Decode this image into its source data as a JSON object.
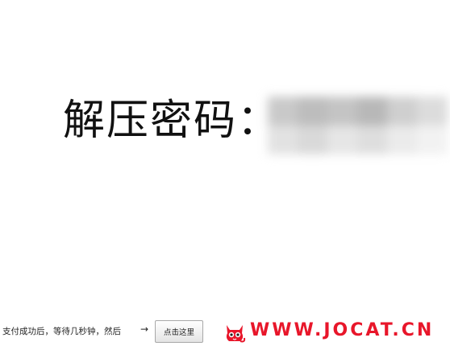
{
  "heading": {
    "label": "解压密码："
  },
  "footer": {
    "instruction": "支付成功后，等待几秒钟，然后",
    "arrow": "→",
    "button_label": "点击这里"
  },
  "logo": {
    "text": "WWW.JOCAT.CN",
    "icon": "cat-icon",
    "color": "#e8162a"
  }
}
